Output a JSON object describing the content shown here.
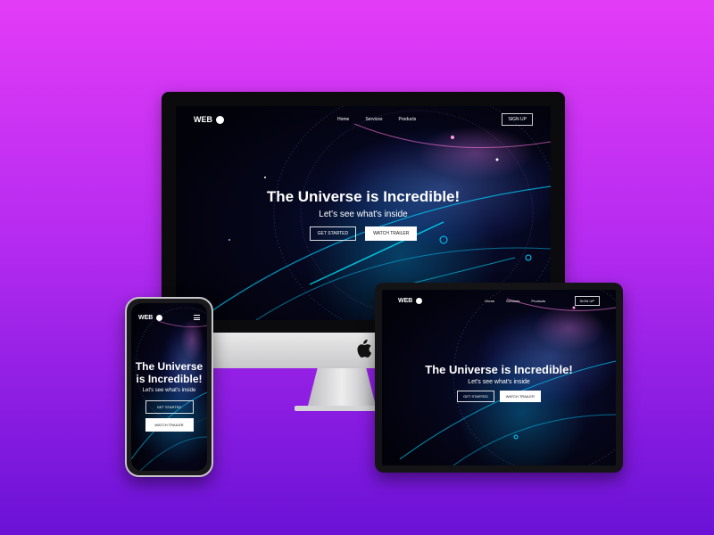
{
  "site": {
    "logo_text": "WEB",
    "logo_icon": "globe-icon",
    "nav_links": [
      "Home",
      "Services",
      "Products"
    ],
    "signup_label": "SIGN UP",
    "hero_title": "The Universe is Incredible!",
    "hero_subtitle": "Let's see what's inside",
    "primary_button": "GET STARTED",
    "secondary_button": "WATCH TRAILER"
  },
  "colors": {
    "background_top": "#e33cf7",
    "background_bottom": "#6a12d6",
    "screen_dark": "#05061a",
    "accent_cyan": "#00d2ff",
    "accent_pink": "#ff78dc"
  },
  "devices": [
    "desktop-monitor",
    "tablet",
    "phone"
  ]
}
